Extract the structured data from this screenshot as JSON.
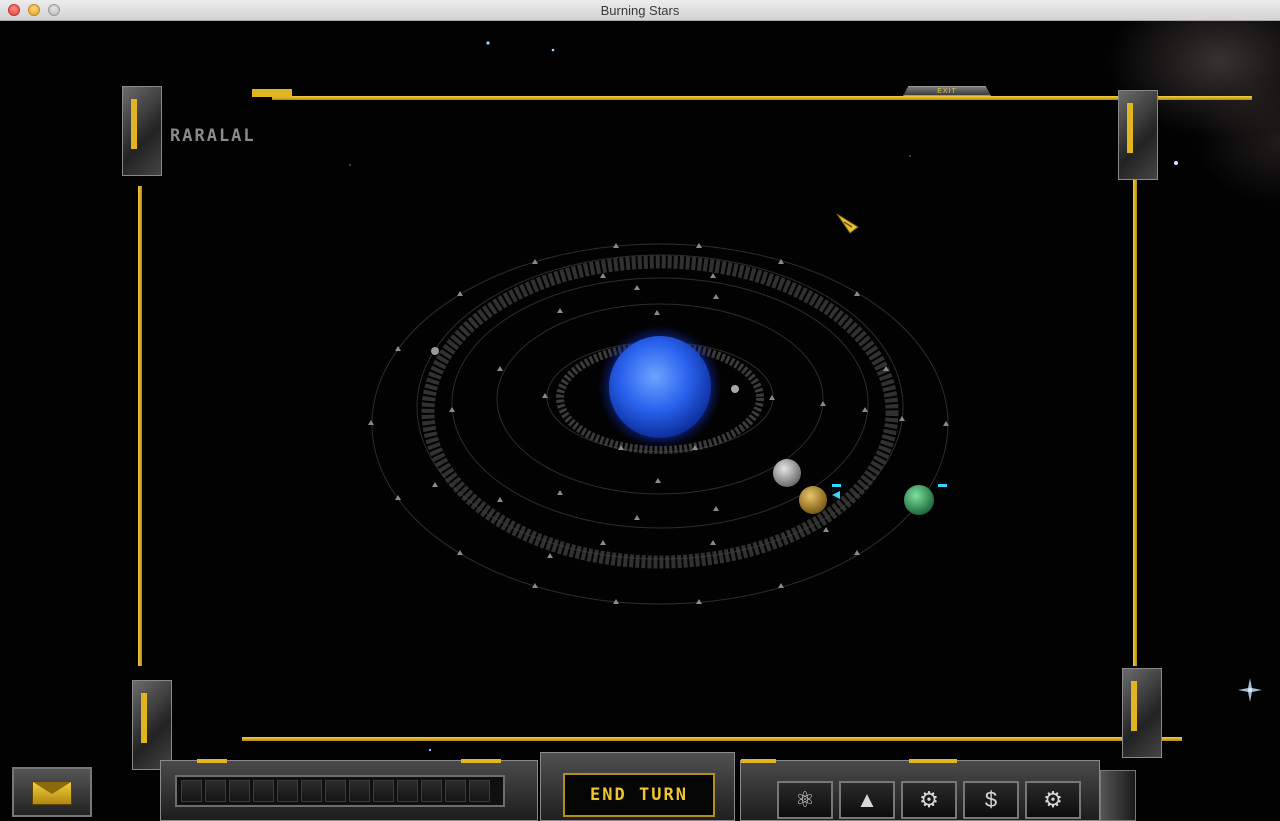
{
  "window": {
    "title": "Burning Stars"
  },
  "frame": {
    "system_name": "RARALAL",
    "exit_label": "EXIT"
  },
  "hud": {
    "end_turn_label": "END TURN"
  },
  "icons": {
    "mail": "envelope-icon",
    "research": "atom-icon",
    "ships": "rocket-icon",
    "production": "gear-icon",
    "economy": "dollar-icon",
    "settings": "gear-icon"
  },
  "colors": {
    "accent": "#e0b520",
    "star": "#2f6bff",
    "end_turn_text": "#f0c52a"
  }
}
